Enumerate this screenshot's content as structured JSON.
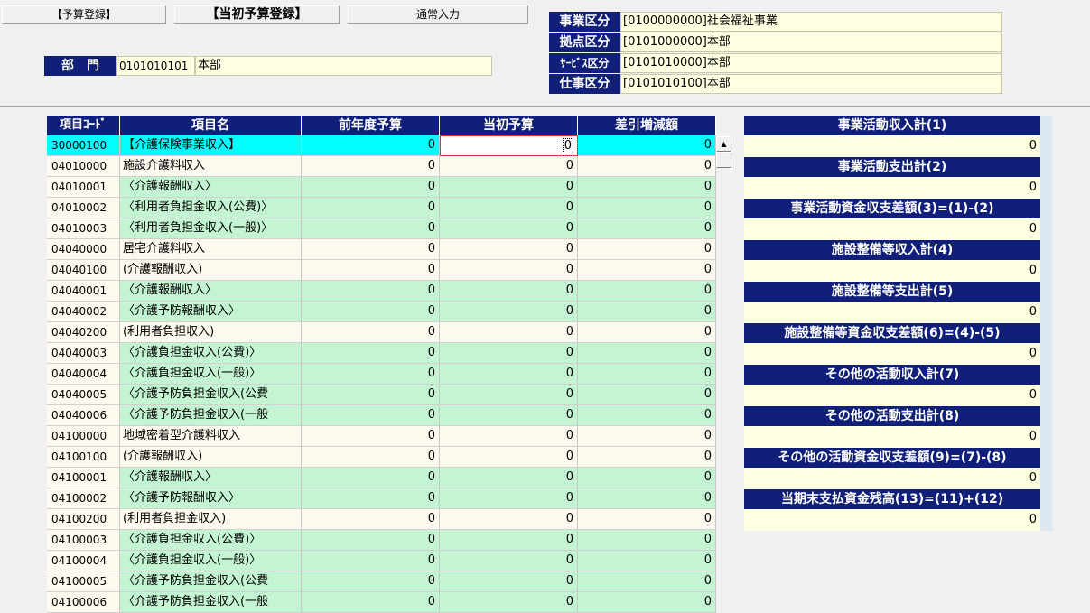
{
  "tabs": [
    {
      "label": "【予算登録】"
    },
    {
      "label": "【当初予算登録】"
    },
    {
      "label": "通常入力"
    }
  ],
  "department": {
    "label": "部　門",
    "code": "0101010101",
    "name": "本部"
  },
  "classifications": [
    {
      "label": "事業区分",
      "value": "[0100000000]社会福祉事業"
    },
    {
      "label": "拠点区分",
      "value": "[0101000000]本部"
    },
    {
      "label": "ｻｰﾋﾞｽ区分",
      "value": "[0101010000]本部"
    },
    {
      "label": "仕事区分",
      "value": "[0101010100]本部"
    }
  ],
  "grid": {
    "headers": [
      "項目ｺｰﾄﾞ",
      "項目名",
      "前年度予算",
      "当初予算",
      "差引増減額"
    ],
    "rows": [
      {
        "code": "30000100",
        "name": "【介護保険事業収入】",
        "prev": "0",
        "initial": "0",
        "diff": "0",
        "style": "sel"
      },
      {
        "code": "04010000",
        "name": "施設介護料収入",
        "prev": "0",
        "initial": "0",
        "diff": "0",
        "style": "white"
      },
      {
        "code": "04010001",
        "name": "〈介護報酬収入〉",
        "prev": "0",
        "initial": "0",
        "diff": "0",
        "style": "green"
      },
      {
        "code": "04010002",
        "name": "〈利用者負担金収入(公費)〉",
        "prev": "0",
        "initial": "0",
        "diff": "0",
        "style": "green"
      },
      {
        "code": "04010003",
        "name": "〈利用者負担金収入(一般)〉",
        "prev": "0",
        "initial": "0",
        "diff": "0",
        "style": "green"
      },
      {
        "code": "04040000",
        "name": "居宅介護料収入",
        "prev": "0",
        "initial": "0",
        "diff": "0",
        "style": "white"
      },
      {
        "code": "04040100",
        "name": "(介護報酬収入)",
        "prev": "0",
        "initial": "0",
        "diff": "0",
        "style": "white"
      },
      {
        "code": "04040001",
        "name": "〈介護報酬収入〉",
        "prev": "0",
        "initial": "0",
        "diff": "0",
        "style": "green"
      },
      {
        "code": "04040002",
        "name": "〈介護予防報酬収入〉",
        "prev": "0",
        "initial": "0",
        "diff": "0",
        "style": "green"
      },
      {
        "code": "04040200",
        "name": "(利用者負担収入)",
        "prev": "0",
        "initial": "0",
        "diff": "0",
        "style": "white"
      },
      {
        "code": "04040003",
        "name": "〈介護負担金収入(公費)〉",
        "prev": "0",
        "initial": "0",
        "diff": "0",
        "style": "green"
      },
      {
        "code": "04040004",
        "name": "〈介護負担金収入(一般)〉",
        "prev": "0",
        "initial": "0",
        "diff": "0",
        "style": "green"
      },
      {
        "code": "04040005",
        "name": "〈介護予防負担金収入(公費",
        "prev": "0",
        "initial": "0",
        "diff": "0",
        "style": "green"
      },
      {
        "code": "04040006",
        "name": "〈介護予防負担金収入(一般",
        "prev": "0",
        "initial": "0",
        "diff": "0",
        "style": "green"
      },
      {
        "code": "04100000",
        "name": "地域密着型介護料収入",
        "prev": "0",
        "initial": "0",
        "diff": "0",
        "style": "white"
      },
      {
        "code": "04100100",
        "name": "(介護報酬収入)",
        "prev": "0",
        "initial": "0",
        "diff": "0",
        "style": "white"
      },
      {
        "code": "04100001",
        "name": "〈介護報酬収入〉",
        "prev": "0",
        "initial": "0",
        "diff": "0",
        "style": "green"
      },
      {
        "code": "04100002",
        "name": "〈介護予防報酬収入〉",
        "prev": "0",
        "initial": "0",
        "diff": "0",
        "style": "green"
      },
      {
        "code": "04100200",
        "name": "(利用者負担金収入)",
        "prev": "0",
        "initial": "0",
        "diff": "0",
        "style": "white"
      },
      {
        "code": "04100003",
        "name": "〈介護負担金収入(公費)〉",
        "prev": "0",
        "initial": "0",
        "diff": "0",
        "style": "green"
      },
      {
        "code": "04100004",
        "name": "〈介護負担金収入(一般)〉",
        "prev": "0",
        "initial": "0",
        "diff": "0",
        "style": "green"
      },
      {
        "code": "04100005",
        "name": "〈介護予防負担金収入(公費",
        "prev": "0",
        "initial": "0",
        "diff": "0",
        "style": "green"
      },
      {
        "code": "04100006",
        "name": "〈介護予防負担金収入(一般",
        "prev": "0",
        "initial": "0",
        "diff": "0",
        "style": "green"
      }
    ]
  },
  "summary": [
    {
      "title": "事業活動収入計(1)",
      "value": "0"
    },
    {
      "title": "事業活動支出計(2)",
      "value": "0"
    },
    {
      "title": "事業活動資金収支差額(3)=(1)-(2)",
      "value": "0"
    },
    {
      "title": "施設整備等収入計(4)",
      "value": "0"
    },
    {
      "title": "施設整備等支出計(5)",
      "value": "0"
    },
    {
      "title": "施設整備等資金収支差額(6)=(4)-(5)",
      "value": "0"
    },
    {
      "title": "その他の活動収入計(7)",
      "value": "0"
    },
    {
      "title": "その他の活動支出計(8)",
      "value": "0"
    },
    {
      "title": "その他の活動資金収支差額(9)=(7)-(8)",
      "value": "0"
    },
    {
      "title": "当期末支払資金残高(13)=(11)+(12)",
      "value": "0"
    }
  ],
  "scrollbar": {
    "up_arrow": "▲",
    "down_arrow": "▼"
  },
  "colors": {
    "header_navy": "#0f1f7a",
    "selected_row": "#00ffff",
    "editable_green": "#c4f5d3",
    "field_cream": "#ffffe1"
  }
}
